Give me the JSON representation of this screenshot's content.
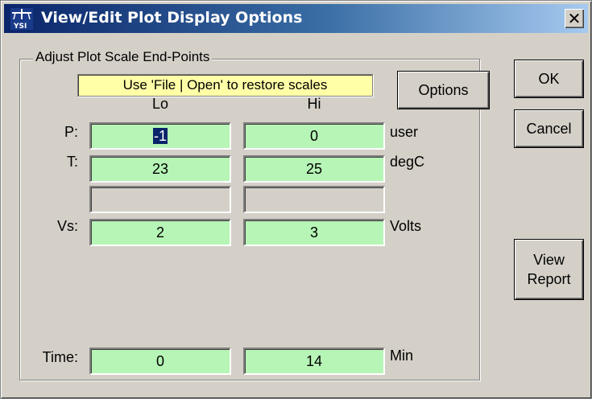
{
  "window": {
    "title": "View/Edit Plot Display Options",
    "close_glyph": "✕",
    "icon": "ysi-app-icon"
  },
  "group": {
    "label": "Adjust Plot Scale End-Points",
    "hint": "Use 'File | Open' to restore scales"
  },
  "buttons": {
    "options": "Options",
    "ok": "OK",
    "cancel": "Cancel",
    "view_report_line1": "View",
    "view_report_line2": "Report"
  },
  "columns": {
    "lo": "Lo",
    "hi": "Hi"
  },
  "rows": [
    {
      "label": "P:",
      "lo": "-1",
      "hi": "0",
      "unit": "user"
    },
    {
      "label": "T:",
      "lo": "23",
      "hi": "25",
      "unit": "degC"
    },
    {
      "label": "",
      "lo": "",
      "hi": "",
      "unit": ""
    },
    {
      "label": "Vs:",
      "lo": "2",
      "hi": "3",
      "unit": "Volts"
    },
    {
      "label": "Time:",
      "lo": "0",
      "hi": "14",
      "unit": "Min"
    }
  ],
  "colors": {
    "field_bg": "#b6f5b6",
    "hint_bg": "#ffffa8",
    "title_start": "#0a246a",
    "title_end": "#a6caf0"
  }
}
